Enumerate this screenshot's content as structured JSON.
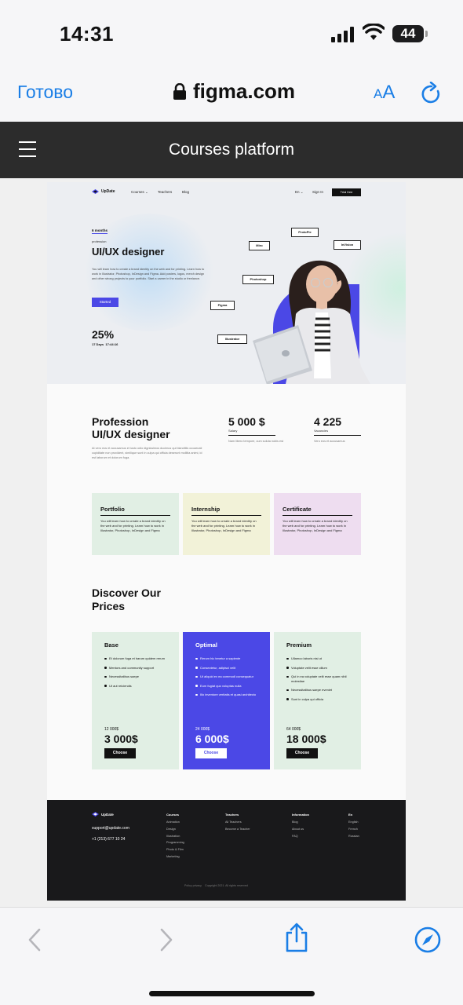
{
  "status": {
    "time": "14:31",
    "battery": "44"
  },
  "browser": {
    "done": "Готово",
    "host": "figma.com",
    "text_size_small": "A",
    "text_size_large": "A"
  },
  "tab_title": "Courses platform",
  "site": {
    "logo": "UpDate",
    "nav": {
      "courses": "Courses",
      "teachers": "Teachers",
      "blog": "Blog",
      "lang": "En",
      "signin": "Sign In",
      "trial": "Trial free"
    },
    "hero": {
      "months": "6 months",
      "profession": "profession",
      "title": "UI/UX designer",
      "desc": "You will learn how to create a brand identity on the web and for printing. Learn how to work in Illustrator, Photoshop, InDesign and Figma. Add posters, logos, merch design and other strong projects to your portfolio. Start a career in the studio or freelance.",
      "button": "Started",
      "percent": "25%",
      "countdown_days": "17 Days",
      "countdown_time": "17:44:16",
      "tags": {
        "protopie": "ProtoPie",
        "miro": "Miro",
        "invision": "InVision",
        "photoshop": "Photoshop",
        "figma": "Figma",
        "illustrator": "Illustrator"
      }
    },
    "profession": {
      "title_line1": "Profession",
      "title_line2": "UI/UX designer",
      "desc": "At vero eos et accusamus et iusto odio dignissimos ducimus qui blanditiis  occaecati cupiditate non provident, similique sunt in culpa qui officia deserunt mollitia animi, id est laborum et dolorum fuga.",
      "salary_value": "5 000 $",
      "salary_label": "Salary",
      "salary_sub": "Nam libero tempore, cum soluta nobis est",
      "vacancies_value": "4 225",
      "vacancies_label": "Vacancies",
      "vacancies_sub": "Vero eos et accusamus"
    },
    "cards": [
      {
        "title": "Portfolio",
        "text": "You will learn how to create a brand identity on the web and for printing. Learn how to work in Illustrator, Photoshop, InDesign and Figma",
        "color": "#e1efe4"
      },
      {
        "title": "Internship",
        "text": "You will learn how to create a brand identity on the web and for printing. Learn how to work in Illustrator, Photoshop, InDesign and Figma",
        "color": "#f2f2d8"
      },
      {
        "title": "Certificate",
        "text": "You will learn how to create a brand identity on the web and for printing. Learn how to work in Illustrator, Photoshop, InDesign and Figma",
        "color": "#eeddf0"
      }
    ],
    "prices_title_line1": "Discover Our",
    "prices_title_line2": "Prices",
    "prices": [
      {
        "name": "Base",
        "items": [
          "Et dolorum fuga et harum quidem rerum",
          "Mentors and community support",
          "Necessitatibus saepe",
          "Ut aut reiciendis"
        ],
        "old": "12 000$",
        "new": "3 000$",
        "button": "Choose"
      },
      {
        "name": "Optimal",
        "items": [
          "Rerum hic tenetur a sapiente",
          "Consectetur, adipisci velit",
          "Ut aliquid ex ea commodi consequatur",
          "Eum fugiat quo voluptas nulla",
          "Illo inventore veritatis et quasi architecto"
        ],
        "old": "24 000$",
        "new": "6 000$",
        "button": "Choose"
      },
      {
        "name": "Premium",
        "items": [
          "Ullamco laboris nisi ut",
          "Voluptate velit esse cillum",
          "Qui in ea voluptate velit esse quam nihil molestiae",
          "Necessitatibus saepe eveniet",
          "Sunt in culpa qui officia"
        ],
        "old": "64 000$",
        "new": "18 000$",
        "button": "Choose"
      }
    ],
    "footer": {
      "logo": "UpDate",
      "email": "support@update.com",
      "phone": "+1 (213) 677 10 24",
      "courses_title": "Courses",
      "courses": [
        "Animation",
        "Design",
        "Illustration",
        "Programming",
        "Photo & Film",
        "Marketing"
      ],
      "teachers_title": "Teachers",
      "teachers": [
        "All Teachers",
        "Become a Teacher"
      ],
      "info_title": "Information",
      "info": [
        "Blog",
        "About us",
        "FAQ"
      ],
      "lang_title": "En",
      "langs": [
        "English",
        "French",
        "Russian"
      ],
      "privacy": "Policy privacy",
      "copyright": "Copyright 2021. All rights reserved"
    }
  },
  "colors": {
    "accent": "#4b48e6",
    "ios_blue": "#1a7ee6",
    "dark": "#2c2c2c",
    "footer": "#19191b"
  }
}
